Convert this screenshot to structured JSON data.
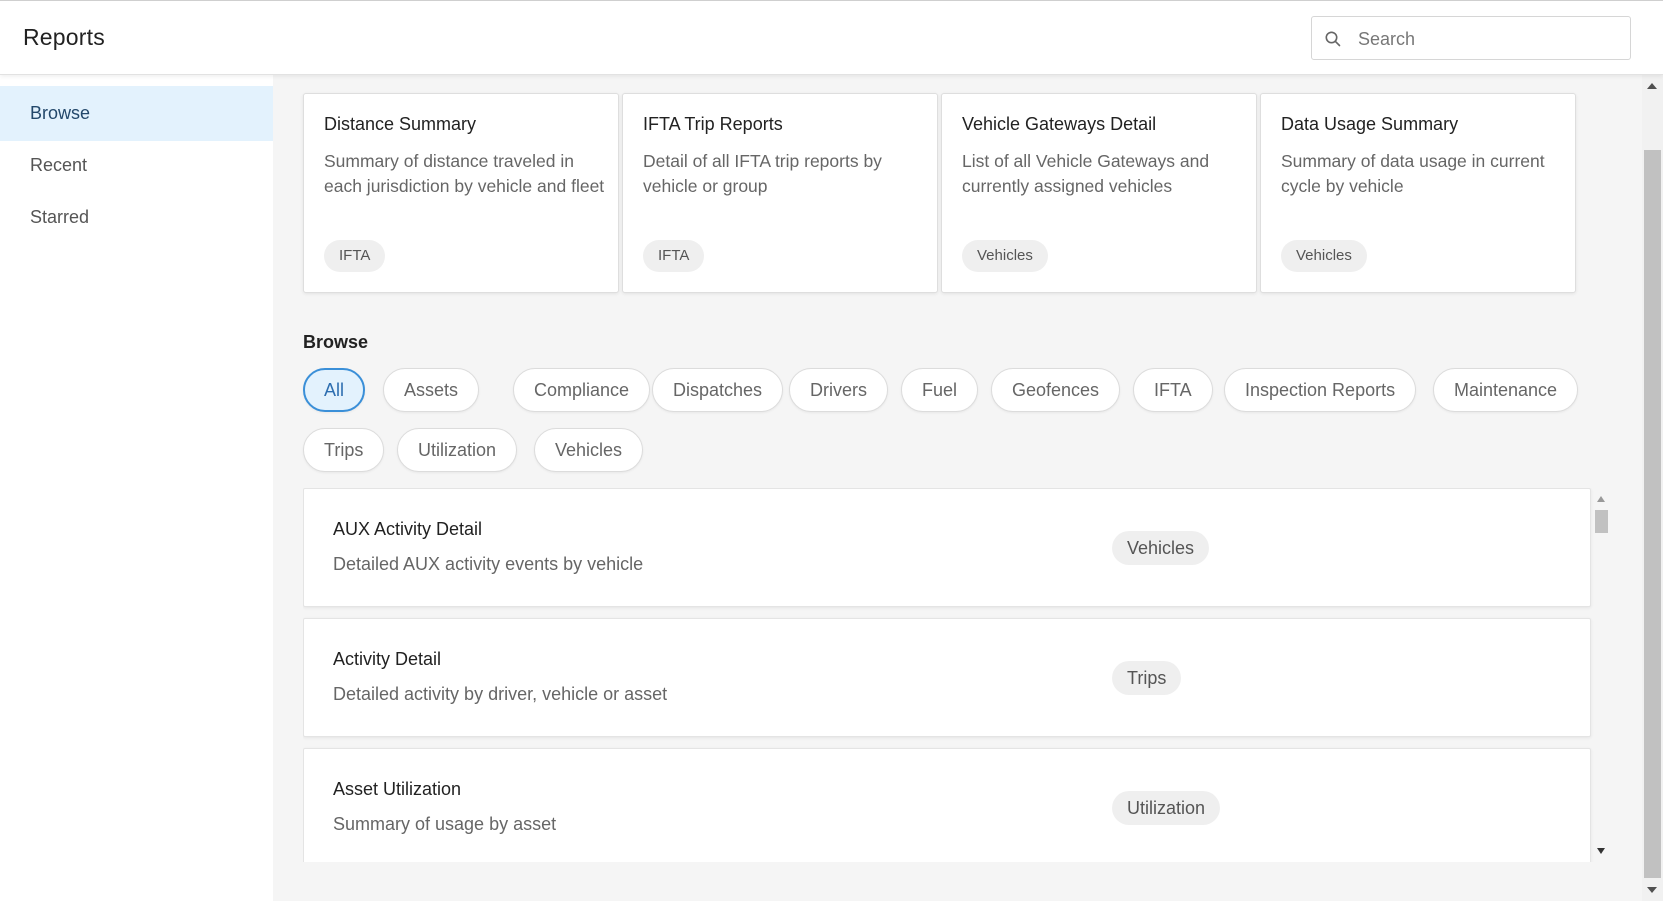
{
  "header": {
    "title": "Reports",
    "search_placeholder": "Search",
    "search_value": ""
  },
  "sidebar": {
    "items": [
      {
        "label": "Browse",
        "active": true
      },
      {
        "label": "Recent",
        "active": false
      },
      {
        "label": "Starred",
        "active": false
      }
    ]
  },
  "featured": {
    "cards": [
      {
        "title": "Distance Summary",
        "description": "Summary of distance traveled in each jurisdiction by vehicle and fleet",
        "tag": "IFTA"
      },
      {
        "title": "IFTA Trip Reports",
        "description": "Detail of all IFTA trip reports by vehicle or group",
        "tag": "IFTA"
      },
      {
        "title": "Vehicle Gateways Detail",
        "description": "List of all Vehicle Gateways and currently assigned vehicles",
        "tag": "Vehicles"
      },
      {
        "title": "Data Usage Summary",
        "description": "Summary of data usage in current cycle by vehicle",
        "tag": "Vehicles"
      }
    ]
  },
  "browse": {
    "title": "Browse",
    "filters": [
      {
        "label": "All",
        "active": true
      },
      {
        "label": "Assets"
      },
      {
        "label": "Compliance"
      },
      {
        "label": "Dispatches"
      },
      {
        "label": "Drivers"
      },
      {
        "label": "Fuel"
      },
      {
        "label": "Geofences"
      },
      {
        "label": "IFTA"
      },
      {
        "label": "Inspection Reports"
      },
      {
        "label": "Maintenance"
      },
      {
        "label": "Trips"
      },
      {
        "label": "Utilization"
      },
      {
        "label": "Vehicles"
      }
    ],
    "reports": [
      {
        "title": "AUX Activity Detail",
        "description": "Detailed AUX activity events by vehicle",
        "tag": "Vehicles"
      },
      {
        "title": "Activity Detail",
        "description": "Detailed activity by driver, vehicle or asset",
        "tag": "Trips"
      },
      {
        "title": "Asset Utilization",
        "description": "Summary of usage by asset",
        "tag": "Utilization"
      }
    ]
  },
  "colors": {
    "accent": "#3a8fd8",
    "active_bg": "#e3f2fd",
    "main_bg": "#f5f5f5"
  },
  "icons": {
    "search": "search-icon",
    "scroll_up": "chevron-up-icon",
    "scroll_down": "chevron-down-icon"
  }
}
